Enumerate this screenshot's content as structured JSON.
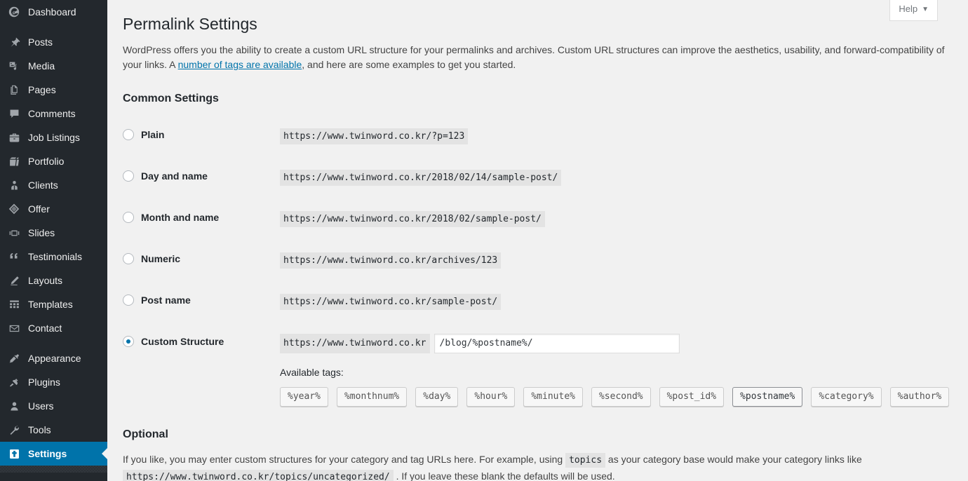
{
  "sidebar": {
    "items": [
      {
        "label": "Dashboard",
        "icon": "dashboard-icon",
        "current": false,
        "sep_after": true
      },
      {
        "label": "Posts",
        "icon": "pin-icon",
        "current": false,
        "sep_after": false
      },
      {
        "label": "Media",
        "icon": "media-icon",
        "current": false,
        "sep_after": false
      },
      {
        "label": "Pages",
        "icon": "pages-icon",
        "current": false,
        "sep_after": false
      },
      {
        "label": "Comments",
        "icon": "comments-icon",
        "current": false,
        "sep_after": false
      },
      {
        "label": "Job Listings",
        "icon": "briefcase-icon",
        "current": false,
        "sep_after": false
      },
      {
        "label": "Portfolio",
        "icon": "portfolio-icon",
        "current": false,
        "sep_after": false
      },
      {
        "label": "Clients",
        "icon": "clients-icon",
        "current": false,
        "sep_after": false
      },
      {
        "label": "Offer",
        "icon": "offer-icon",
        "current": false,
        "sep_after": false
      },
      {
        "label": "Slides",
        "icon": "slides-icon",
        "current": false,
        "sep_after": false
      },
      {
        "label": "Testimonials",
        "icon": "quote-icon",
        "current": false,
        "sep_after": false
      },
      {
        "label": "Layouts",
        "icon": "pencil-icon",
        "current": false,
        "sep_after": false
      },
      {
        "label": "Templates",
        "icon": "grid-icon",
        "current": false,
        "sep_after": false
      },
      {
        "label": "Contact",
        "icon": "envelope-icon",
        "current": false,
        "sep_after": true
      },
      {
        "label": "Appearance",
        "icon": "brush-icon",
        "current": false,
        "sep_after": false
      },
      {
        "label": "Plugins",
        "icon": "plug-icon",
        "current": false,
        "sep_after": false
      },
      {
        "label": "Users",
        "icon": "user-icon",
        "current": false,
        "sep_after": false
      },
      {
        "label": "Tools",
        "icon": "wrench-icon",
        "current": false,
        "sep_after": false
      },
      {
        "label": "Settings",
        "icon": "settings-icon",
        "current": true,
        "sep_after": false
      }
    ]
  },
  "help": {
    "label": "Help",
    "caret": "▼"
  },
  "page": {
    "title": "Permalink Settings",
    "intro_part1": "WordPress offers you the ability to create a custom URL structure for your permalinks and archives. Custom URL structures can improve the aesthetics, usability, and forward-compatibility of your links. A ",
    "intro_link": "number of tags are available",
    "intro_part2": ", and here are some examples to get you started."
  },
  "common_settings": {
    "heading": "Common Settings",
    "options": [
      {
        "label": "Plain",
        "example": "https://www.twinword.co.kr/?p=123",
        "checked": false
      },
      {
        "label": "Day and name",
        "example": "https://www.twinword.co.kr/2018/02/14/sample-post/",
        "checked": false
      },
      {
        "label": "Month and name",
        "example": "https://www.twinword.co.kr/2018/02/sample-post/",
        "checked": false
      },
      {
        "label": "Numeric",
        "example": "https://www.twinword.co.kr/archives/123",
        "checked": false
      },
      {
        "label": "Post name",
        "example": "https://www.twinword.co.kr/sample-post/",
        "checked": false
      }
    ],
    "custom": {
      "label": "Custom Structure",
      "checked": true,
      "prefix": "https://www.twinword.co.kr",
      "value": "/blog/%postname%/",
      "placeholder": ""
    },
    "available_tags_label": "Available tags:",
    "tags": [
      {
        "label": "%year%",
        "active": false
      },
      {
        "label": "%monthnum%",
        "active": false
      },
      {
        "label": "%day%",
        "active": false
      },
      {
        "label": "%hour%",
        "active": false
      },
      {
        "label": "%minute%",
        "active": false
      },
      {
        "label": "%second%",
        "active": false
      },
      {
        "label": "%post_id%",
        "active": false
      },
      {
        "label": "%postname%",
        "active": true
      },
      {
        "label": "%category%",
        "active": false
      },
      {
        "label": "%author%",
        "active": false
      }
    ]
  },
  "optional": {
    "heading": "Optional",
    "text_part1": "If you like, you may enter custom structures for your category and tag URLs here. For example, using ",
    "code1": "topics",
    "text_part2": " as your category base would make your category links like ",
    "code2": "https://www.twinword.co.kr/topics/uncategorized/",
    "text_part3": " . If you leave these blank the defaults will be used."
  },
  "colors": {
    "sidebar_bg": "#23282d",
    "sidebar_current": "#0073aa",
    "content_bg": "#f1f1f1",
    "link": "#0073aa",
    "code_bg": "#e3e3e3"
  }
}
